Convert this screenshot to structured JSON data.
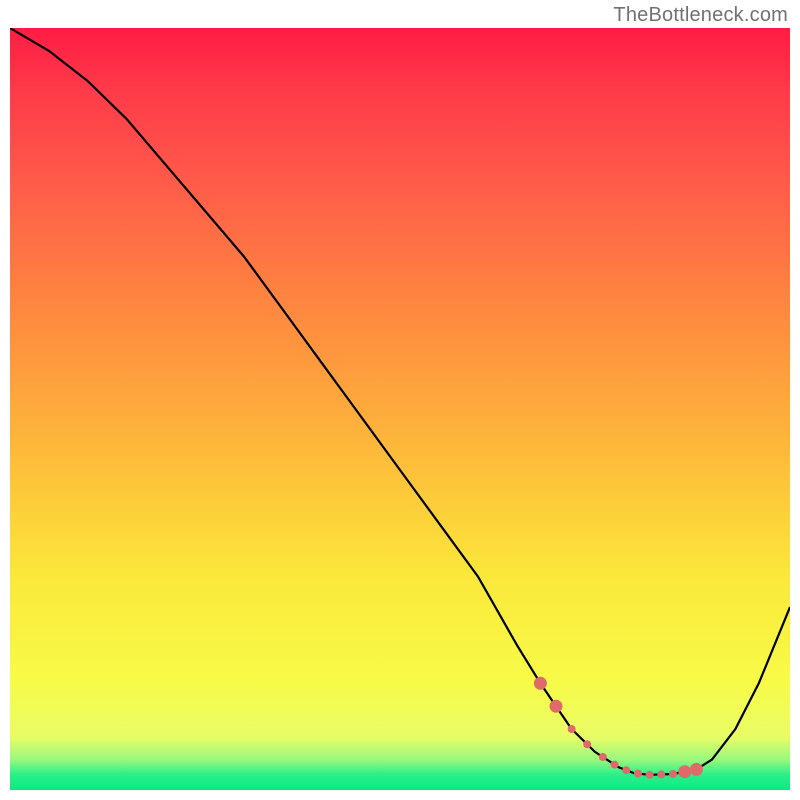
{
  "attribution": "TheBottleneck.com",
  "chart_data": {
    "type": "line",
    "title": "",
    "xlabel": "",
    "ylabel": "",
    "xlim": [
      0,
      100
    ],
    "ylim": [
      0,
      100
    ],
    "x": [
      0,
      5,
      10,
      15,
      20,
      25,
      30,
      35,
      40,
      45,
      50,
      55,
      60,
      65,
      68,
      70,
      72,
      75,
      78,
      80,
      82,
      85,
      88,
      90,
      93,
      96,
      100
    ],
    "values": [
      100,
      97,
      93,
      88,
      82,
      76,
      70,
      63,
      56,
      49,
      42,
      35,
      28,
      19,
      14,
      11,
      8,
      5,
      3,
      2.2,
      2,
      2.1,
      2.7,
      4,
      8,
      14,
      24
    ],
    "notes": "y is bottleneck percentage (higher = worse / redder). Curve has a steep descent from top-left, a flat optimum near x≈78–85, then rises toward the right edge.",
    "marker_region_x": [
      68,
      88
    ],
    "marker_region_note": "salmon dots highlight the low-bottleneck valley"
  },
  "style": {
    "line_color": "#000000",
    "marker_color": "#e06a6a"
  }
}
